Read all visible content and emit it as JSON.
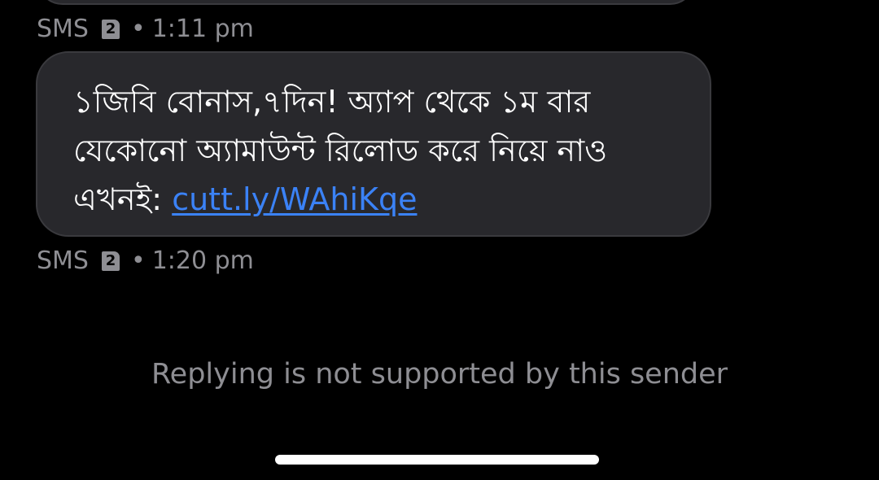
{
  "messages": [
    {
      "meta": {
        "channel": "SMS",
        "sim_slot": "2",
        "time": "1:11 pm"
      }
    },
    {
      "text_lines": [
        "১জিবি বোনাস,৭দিন! অ্যাপ থেকে ১ম বার",
        "যেকোনো অ্যামাউন্ট রিলোড করে নিয়ে নাও"
      ],
      "last_line_prefix": "এখনই: ",
      "link_text": "cutt.ly/WAhiKqe",
      "meta": {
        "channel": "SMS",
        "sim_slot": "2",
        "time": "1:20 pm"
      }
    }
  ],
  "separator": "•",
  "reply_note": "Replying is not supported by this sender",
  "colors": {
    "background": "#000000",
    "bubble": "#28282c",
    "bubble_border": "#3a3a3e",
    "meta_text": "#8e8e93",
    "link": "#3b82f6",
    "home_indicator": "#ffffff"
  },
  "icons": {
    "sim": "sim-card-icon"
  }
}
